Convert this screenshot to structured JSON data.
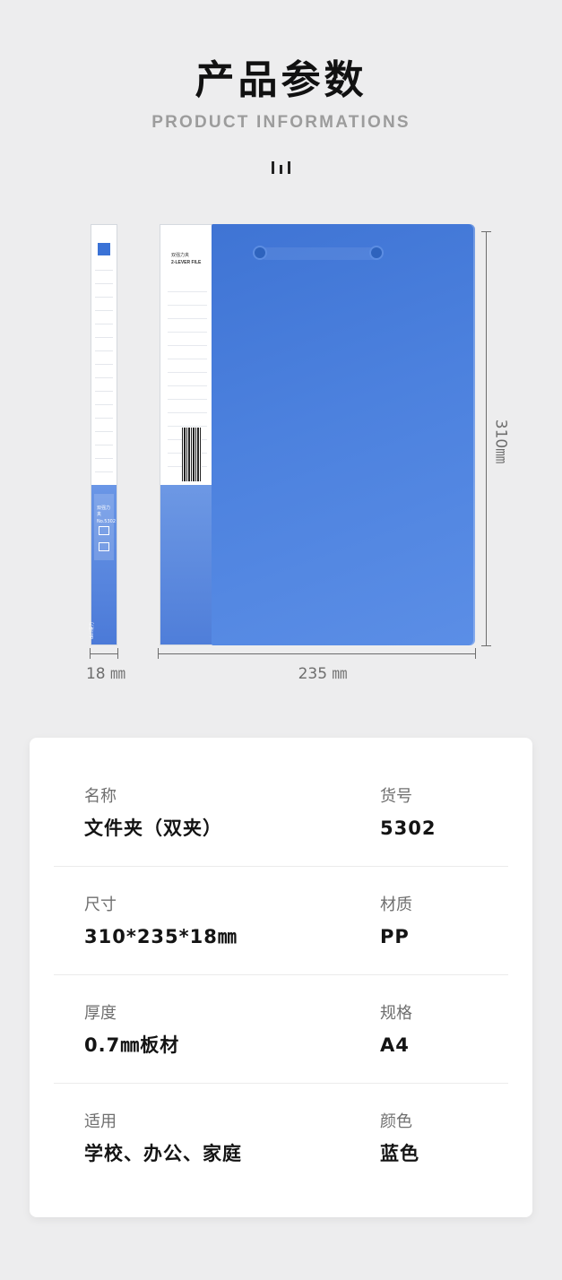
{
  "header": {
    "title": "产品参数",
    "subtitle": "PRODUCT INFORMATIONS"
  },
  "product": {
    "spine_label": "双强力夹",
    "spine_model": "No.5302",
    "spine_brand": "deli得力",
    "label_title_cn": "双强力夹",
    "label_title_en": "2-LEVER FILE",
    "color_accent": "#4a7fdb"
  },
  "dimensions": {
    "width_label": "235 ㎜",
    "height_label": "310㎜",
    "thickness_label": "18 ㎜"
  },
  "specs": [
    {
      "left": {
        "key": "名称",
        "value": "文件夹（双夹）"
      },
      "right": {
        "key": "货号",
        "value": "5302"
      }
    },
    {
      "left": {
        "key": "尺寸",
        "value": "310*235*18㎜"
      },
      "right": {
        "key": "材质",
        "value": "PP"
      }
    },
    {
      "left": {
        "key": "厚度",
        "value": "0.7㎜板材"
      },
      "right": {
        "key": "规格",
        "value": "A4"
      }
    },
    {
      "left": {
        "key": "适用",
        "value": "学校、办公、家庭"
      },
      "right": {
        "key": "颜色",
        "value": "蓝色"
      }
    }
  ]
}
